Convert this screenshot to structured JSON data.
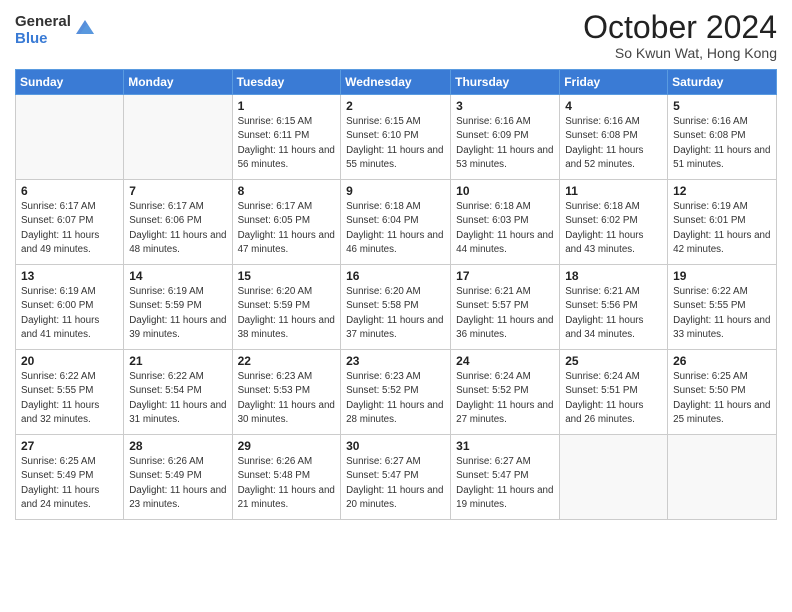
{
  "header": {
    "logo_general": "General",
    "logo_blue": "Blue",
    "month_title": "October 2024",
    "subtitle": "So Kwun Wat, Hong Kong"
  },
  "days_of_week": [
    "Sunday",
    "Monday",
    "Tuesday",
    "Wednesday",
    "Thursday",
    "Friday",
    "Saturday"
  ],
  "weeks": [
    [
      {
        "day": "",
        "info": ""
      },
      {
        "day": "",
        "info": ""
      },
      {
        "day": "1",
        "info": "Sunrise: 6:15 AM\nSunset: 6:11 PM\nDaylight: 11 hours and 56 minutes."
      },
      {
        "day": "2",
        "info": "Sunrise: 6:15 AM\nSunset: 6:10 PM\nDaylight: 11 hours and 55 minutes."
      },
      {
        "day": "3",
        "info": "Sunrise: 6:16 AM\nSunset: 6:09 PM\nDaylight: 11 hours and 53 minutes."
      },
      {
        "day": "4",
        "info": "Sunrise: 6:16 AM\nSunset: 6:08 PM\nDaylight: 11 hours and 52 minutes."
      },
      {
        "day": "5",
        "info": "Sunrise: 6:16 AM\nSunset: 6:08 PM\nDaylight: 11 hours and 51 minutes."
      }
    ],
    [
      {
        "day": "6",
        "info": "Sunrise: 6:17 AM\nSunset: 6:07 PM\nDaylight: 11 hours and 49 minutes."
      },
      {
        "day": "7",
        "info": "Sunrise: 6:17 AM\nSunset: 6:06 PM\nDaylight: 11 hours and 48 minutes."
      },
      {
        "day": "8",
        "info": "Sunrise: 6:17 AM\nSunset: 6:05 PM\nDaylight: 11 hours and 47 minutes."
      },
      {
        "day": "9",
        "info": "Sunrise: 6:18 AM\nSunset: 6:04 PM\nDaylight: 11 hours and 46 minutes."
      },
      {
        "day": "10",
        "info": "Sunrise: 6:18 AM\nSunset: 6:03 PM\nDaylight: 11 hours and 44 minutes."
      },
      {
        "day": "11",
        "info": "Sunrise: 6:18 AM\nSunset: 6:02 PM\nDaylight: 11 hours and 43 minutes."
      },
      {
        "day": "12",
        "info": "Sunrise: 6:19 AM\nSunset: 6:01 PM\nDaylight: 11 hours and 42 minutes."
      }
    ],
    [
      {
        "day": "13",
        "info": "Sunrise: 6:19 AM\nSunset: 6:00 PM\nDaylight: 11 hours and 41 minutes."
      },
      {
        "day": "14",
        "info": "Sunrise: 6:19 AM\nSunset: 5:59 PM\nDaylight: 11 hours and 39 minutes."
      },
      {
        "day": "15",
        "info": "Sunrise: 6:20 AM\nSunset: 5:59 PM\nDaylight: 11 hours and 38 minutes."
      },
      {
        "day": "16",
        "info": "Sunrise: 6:20 AM\nSunset: 5:58 PM\nDaylight: 11 hours and 37 minutes."
      },
      {
        "day": "17",
        "info": "Sunrise: 6:21 AM\nSunset: 5:57 PM\nDaylight: 11 hours and 36 minutes."
      },
      {
        "day": "18",
        "info": "Sunrise: 6:21 AM\nSunset: 5:56 PM\nDaylight: 11 hours and 34 minutes."
      },
      {
        "day": "19",
        "info": "Sunrise: 6:22 AM\nSunset: 5:55 PM\nDaylight: 11 hours and 33 minutes."
      }
    ],
    [
      {
        "day": "20",
        "info": "Sunrise: 6:22 AM\nSunset: 5:55 PM\nDaylight: 11 hours and 32 minutes."
      },
      {
        "day": "21",
        "info": "Sunrise: 6:22 AM\nSunset: 5:54 PM\nDaylight: 11 hours and 31 minutes."
      },
      {
        "day": "22",
        "info": "Sunrise: 6:23 AM\nSunset: 5:53 PM\nDaylight: 11 hours and 30 minutes."
      },
      {
        "day": "23",
        "info": "Sunrise: 6:23 AM\nSunset: 5:52 PM\nDaylight: 11 hours and 28 minutes."
      },
      {
        "day": "24",
        "info": "Sunrise: 6:24 AM\nSunset: 5:52 PM\nDaylight: 11 hours and 27 minutes."
      },
      {
        "day": "25",
        "info": "Sunrise: 6:24 AM\nSunset: 5:51 PM\nDaylight: 11 hours and 26 minutes."
      },
      {
        "day": "26",
        "info": "Sunrise: 6:25 AM\nSunset: 5:50 PM\nDaylight: 11 hours and 25 minutes."
      }
    ],
    [
      {
        "day": "27",
        "info": "Sunrise: 6:25 AM\nSunset: 5:49 PM\nDaylight: 11 hours and 24 minutes."
      },
      {
        "day": "28",
        "info": "Sunrise: 6:26 AM\nSunset: 5:49 PM\nDaylight: 11 hours and 23 minutes."
      },
      {
        "day": "29",
        "info": "Sunrise: 6:26 AM\nSunset: 5:48 PM\nDaylight: 11 hours and 21 minutes."
      },
      {
        "day": "30",
        "info": "Sunrise: 6:27 AM\nSunset: 5:47 PM\nDaylight: 11 hours and 20 minutes."
      },
      {
        "day": "31",
        "info": "Sunrise: 6:27 AM\nSunset: 5:47 PM\nDaylight: 11 hours and 19 minutes."
      },
      {
        "day": "",
        "info": ""
      },
      {
        "day": "",
        "info": ""
      }
    ]
  ]
}
